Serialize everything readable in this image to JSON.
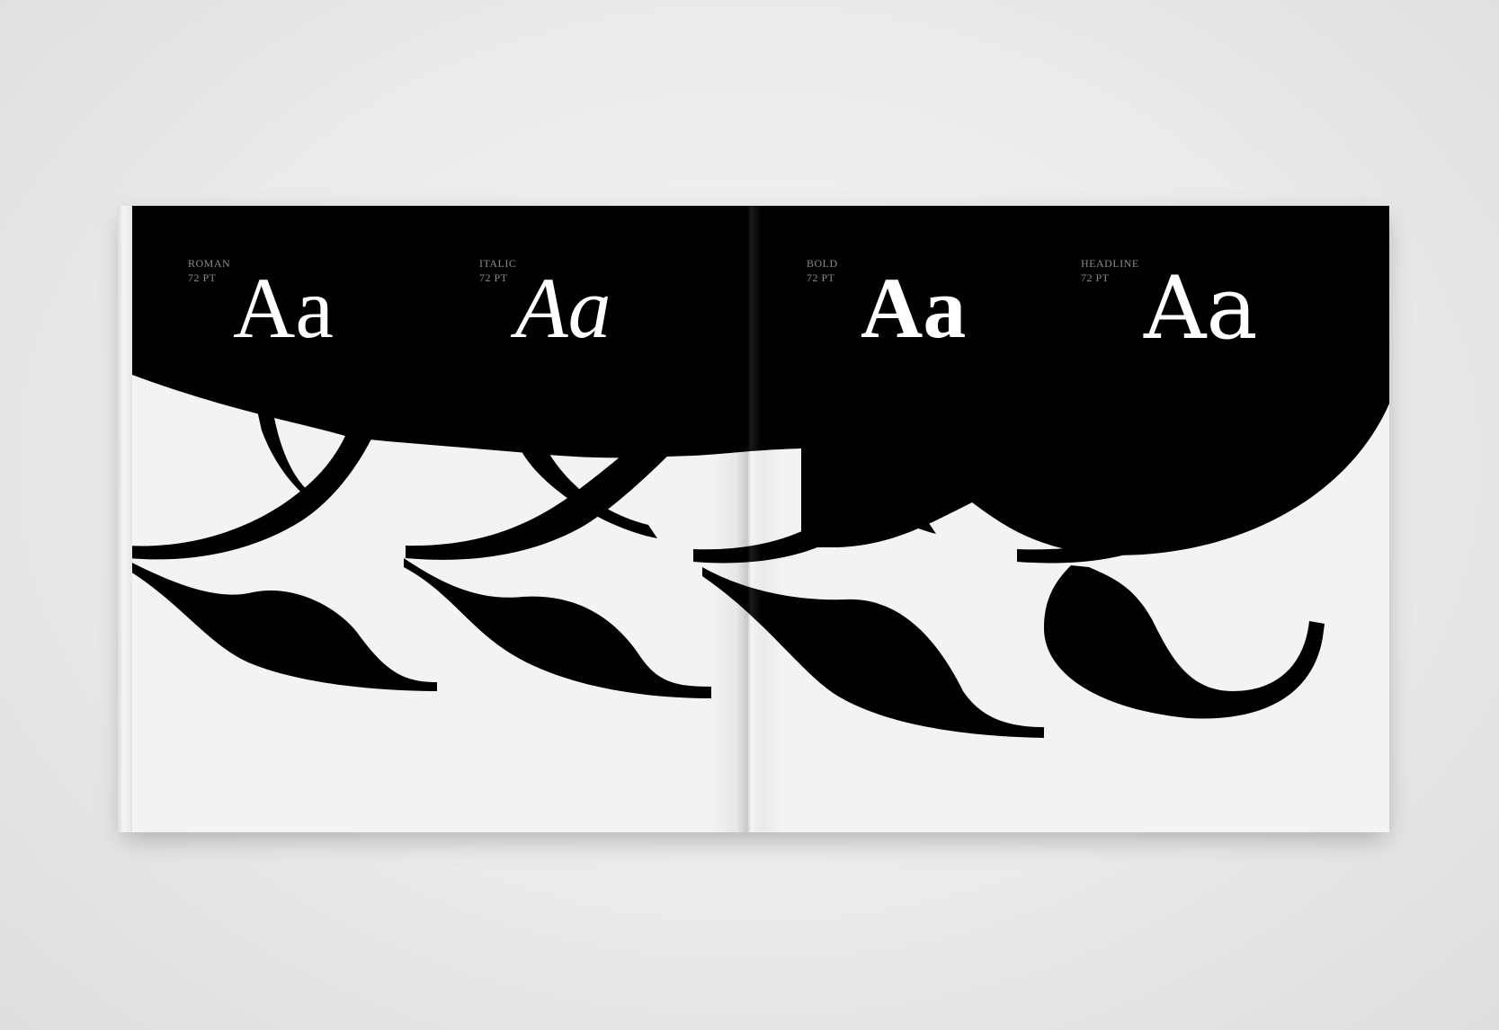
{
  "styles": [
    {
      "name": "ROMAN",
      "size": "72 PT",
      "sample": "Aa"
    },
    {
      "name": "ITALIC",
      "size": "72 PT",
      "sample": "Aa"
    },
    {
      "name": "BOLD",
      "size": "72 PT",
      "sample": "Aa"
    },
    {
      "name": "HEADLINE",
      "size": "72 PT",
      "sample": "Aa"
    }
  ],
  "colors": {
    "ink": "#000000",
    "paper": "#f3f3f3",
    "label": "#8c8c8c"
  }
}
